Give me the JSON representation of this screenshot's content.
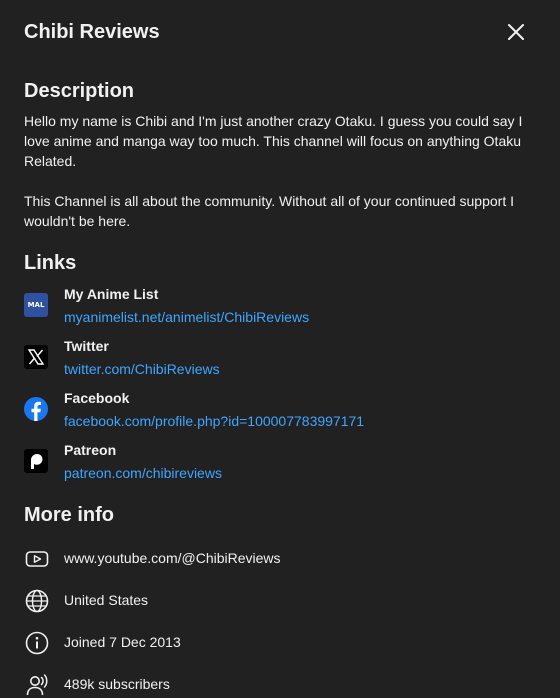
{
  "header": {
    "title": "Chibi Reviews"
  },
  "description": {
    "heading": "Description",
    "paragraphs": [
      "Hello my name is Chibi and I'm just another crazy Otaku. I guess you could say I love anime and manga way too much. This channel will focus on anything Otaku Related.",
      "This Channel is all about the community. Without all of your continued support I wouldn't be here."
    ]
  },
  "links": {
    "heading": "Links",
    "items": [
      {
        "title": "My Anime List",
        "url": "myanimelist.net/animelist/ChibiReviews",
        "icon": "myanimelist-icon",
        "icon_text": "MAL",
        "color": "#2e51a2"
      },
      {
        "title": "Twitter",
        "url": "twitter.com/ChibiReviews",
        "icon": "x-twitter-icon",
        "color": "#000000"
      },
      {
        "title": "Facebook",
        "url": "facebook.com/profile.php?id=100007783997171",
        "icon": "facebook-icon",
        "color": "#1877f2"
      },
      {
        "title": "Patreon",
        "url": "patreon.com/chibireviews",
        "icon": "patreon-icon",
        "color": "#000000"
      }
    ]
  },
  "more_info": {
    "heading": "More info",
    "items": [
      {
        "text": "www.youtube.com/@ChibiReviews",
        "icon": "youtube-icon"
      },
      {
        "text": "United States",
        "icon": "globe-icon"
      },
      {
        "text": "Joined 7 Dec 2013",
        "icon": "info-icon"
      },
      {
        "text": "489k subscribers",
        "icon": "subscribers-icon"
      }
    ]
  },
  "colors": {
    "background": "#212121",
    "text": "#f1f1f1",
    "link": "#3ea6ff"
  }
}
